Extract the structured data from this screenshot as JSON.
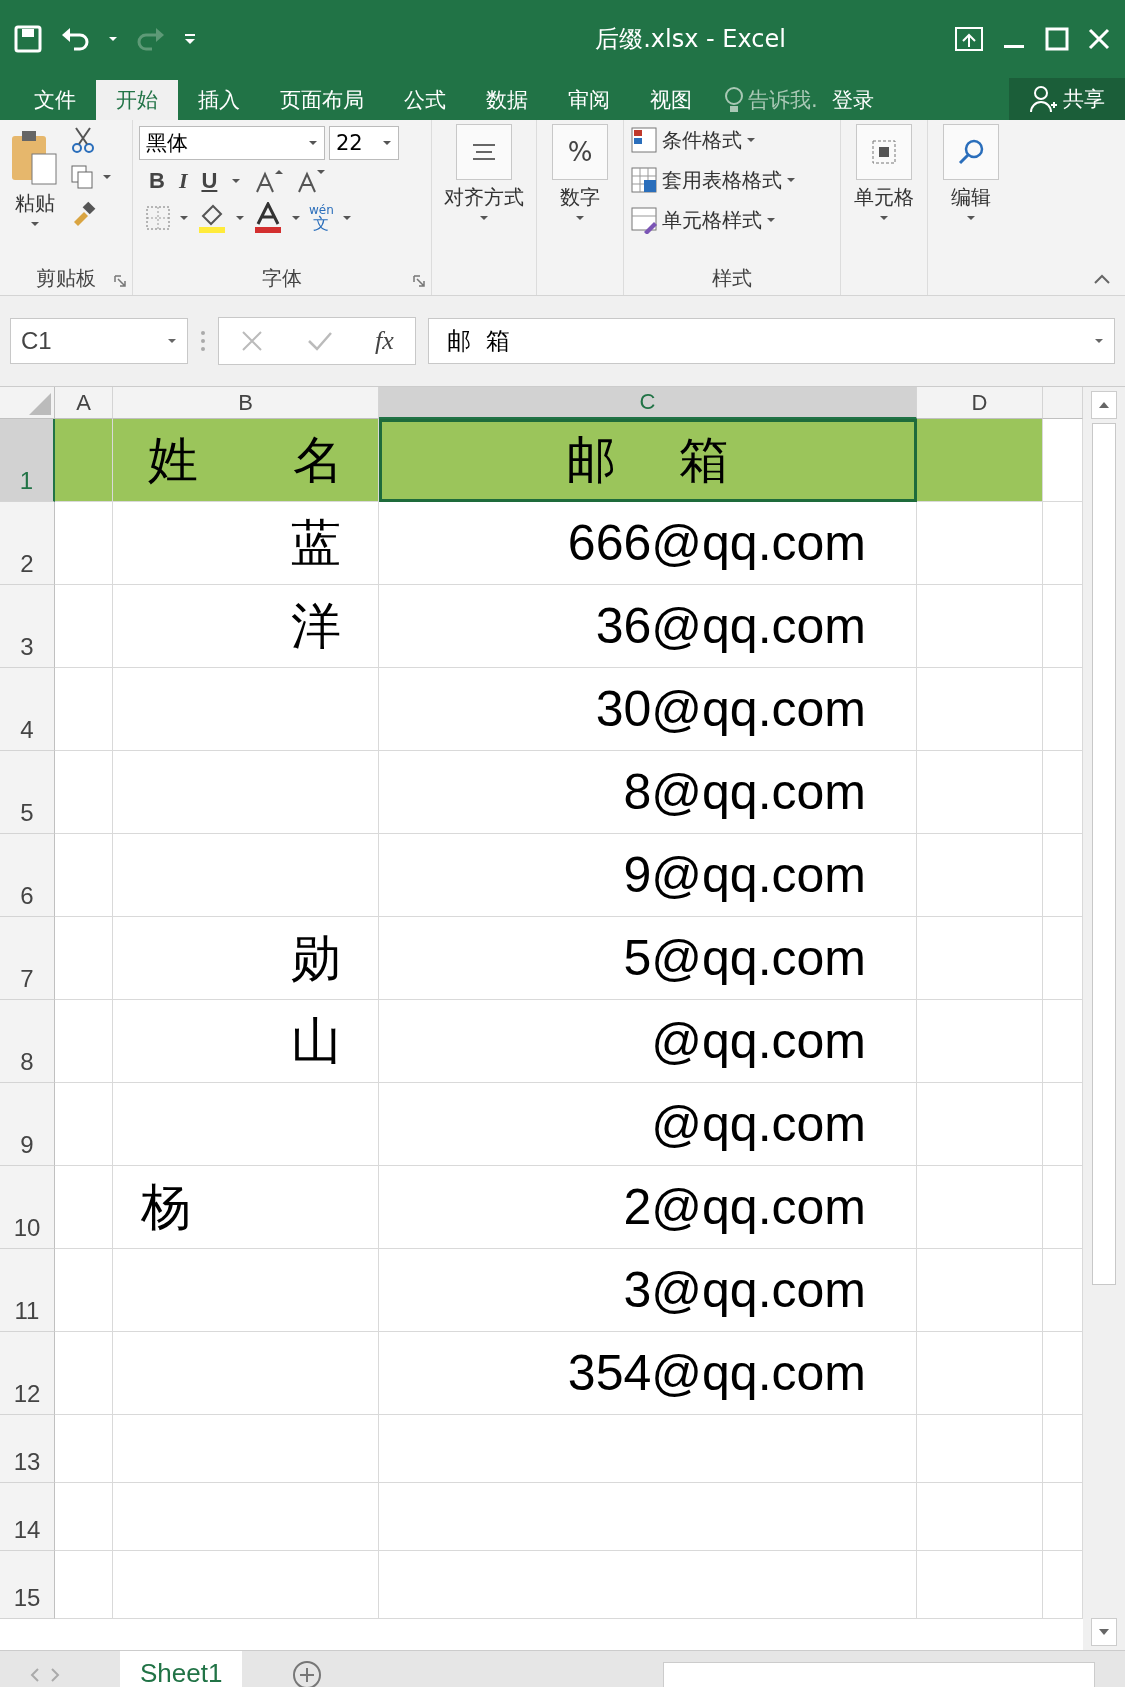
{
  "window": {
    "title": "后缀.xlsx - Excel"
  },
  "tabs": [
    {
      "label": "文件",
      "selected": false
    },
    {
      "label": "开始",
      "selected": true
    },
    {
      "label": "插入",
      "selected": false
    },
    {
      "label": "页面布局",
      "selected": false
    },
    {
      "label": "公式",
      "selected": false
    },
    {
      "label": "数据",
      "selected": false
    },
    {
      "label": "审阅",
      "selected": false
    },
    {
      "label": "视图",
      "selected": false
    }
  ],
  "tell_me": "告诉我.",
  "sign_in": "登录",
  "share": "共享",
  "ribbon": {
    "paste": "粘贴",
    "clipboard": "剪贴板",
    "font_name": "黑体",
    "font_size": "22",
    "bold": "B",
    "italic": "I",
    "underline": "U",
    "phonetic_top": "wén",
    "phonetic_bottom": "文",
    "font": "字体",
    "alignment": "对齐方式",
    "number_symbol": "%",
    "number": "数字",
    "conditional": "条件格式",
    "table_format": "套用表格格式",
    "cell_styles": "单元格样式",
    "styles": "样式",
    "cells": "单元格",
    "editing": "编辑"
  },
  "formula_bar": {
    "name_box": "C1",
    "fx": "fx",
    "value": "邮  箱"
  },
  "columns": [
    {
      "label": "A",
      "selected": false
    },
    {
      "label": "B",
      "selected": false
    },
    {
      "label": "C",
      "selected": true
    },
    {
      "label": "D",
      "selected": false
    }
  ],
  "rows": [
    {
      "number": "1",
      "selected": true,
      "kind": "header",
      "b": "姓      名",
      "c": "邮    箱"
    },
    {
      "number": "2",
      "selected": false,
      "kind": "data",
      "b": "　　　蓝",
      "c": "666@qq.com"
    },
    {
      "number": "3",
      "selected": false,
      "kind": "data",
      "b": "　　　洋",
      "c": "36@qq.com"
    },
    {
      "number": "4",
      "selected": false,
      "kind": "data",
      "c": "30@qq.com"
    },
    {
      "number": "5",
      "selected": false,
      "kind": "data",
      "c": "8@qq.com"
    },
    {
      "number": "6",
      "selected": false,
      "kind": "data",
      "c": "9@qq.com"
    },
    {
      "number": "7",
      "selected": false,
      "kind": "data",
      "b": "　　　勋",
      "c": "5@qq.com"
    },
    {
      "number": "8",
      "selected": false,
      "kind": "data",
      "b": "　　　山",
      "c": "@qq.com"
    },
    {
      "number": "9",
      "selected": false,
      "kind": "data",
      "c": "@qq.com"
    },
    {
      "number": "10",
      "selected": false,
      "kind": "data",
      "b": "杨",
      "c": "2@qq.com"
    },
    {
      "number": "11",
      "selected": false,
      "kind": "data",
      "c": "3@qq.com"
    },
    {
      "number": "12",
      "selected": false,
      "kind": "data",
      "c": "354@qq.com"
    },
    {
      "number": "13",
      "selected": false,
      "kind": "empty"
    },
    {
      "number": "14",
      "selected": false,
      "kind": "empty"
    },
    {
      "number": "15",
      "selected": false,
      "kind": "empty"
    }
  ],
  "sheets": [
    {
      "label": "Sheet1",
      "selected": true
    }
  ]
}
